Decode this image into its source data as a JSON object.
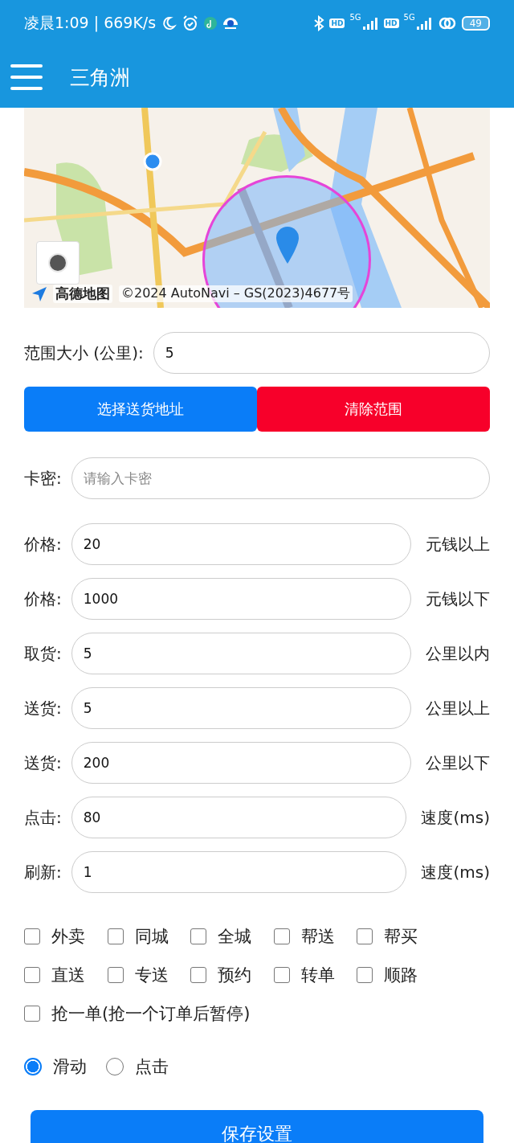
{
  "status_bar": {
    "time": "凌晨1:09 | 669K/s",
    "hd_1": "HD",
    "network_1": "5G",
    "hd_2": "HD",
    "network_2": "5G",
    "battery": "49"
  },
  "app_bar": {
    "title": "三角洲"
  },
  "map": {
    "attribution_logo": "高德地图",
    "attribution": "©2024 AutoNavi – GS(2023)4677号"
  },
  "range": {
    "label": "范围大小 (公里):",
    "value": "5"
  },
  "buttons": [
    {
      "label": "选择送货地址",
      "kind": "primary"
    },
    {
      "label": "清除范围",
      "kind": "danger"
    }
  ],
  "card_key": {
    "label": "卡密:",
    "placeholder": "请输入卡密"
  },
  "fields": [
    {
      "label": "价格:",
      "value": "20",
      "suffix": "元钱以上"
    },
    {
      "label": "价格:",
      "value": "1000",
      "suffix": "元钱以下"
    },
    {
      "label": "取货:",
      "value": "5",
      "suffix": "公里以内"
    },
    {
      "label": "送货:",
      "value": "5",
      "suffix": "公里以上"
    },
    {
      "label": "送货:",
      "value": "200",
      "suffix": "公里以下"
    },
    {
      "label": "点击:",
      "value": "80",
      "suffix": "速度(ms)"
    },
    {
      "label": "刷新:",
      "value": "1",
      "suffix": "速度(ms)"
    }
  ],
  "categories": [
    {
      "label": "外卖",
      "checked": false
    },
    {
      "label": "同城",
      "checked": false
    },
    {
      "label": "全城",
      "checked": false
    },
    {
      "label": "帮送",
      "checked": false
    },
    {
      "label": "帮买",
      "checked": false
    },
    {
      "label": "直送",
      "checked": false
    },
    {
      "label": "专送",
      "checked": false
    },
    {
      "label": "预约",
      "checked": false
    },
    {
      "label": "转单",
      "checked": false
    },
    {
      "label": "顺路",
      "checked": false
    }
  ],
  "grab_one": {
    "label": "抢一单(抢一个订单后暂停)",
    "checked": false
  },
  "modes": [
    {
      "label": "滑动",
      "selected": true
    },
    {
      "label": "点击",
      "selected": false
    }
  ],
  "save_button": {
    "label": "保存设置"
  }
}
